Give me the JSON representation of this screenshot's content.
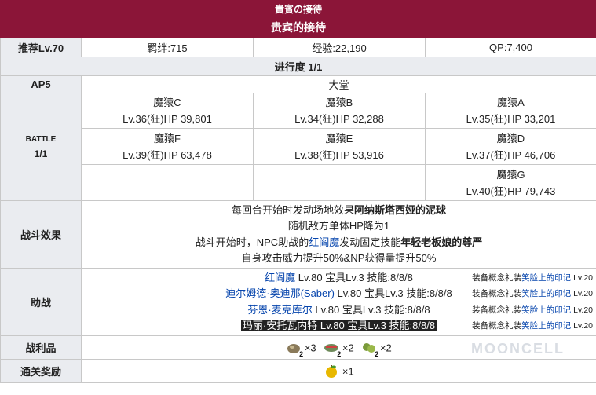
{
  "header": {
    "title_jp": "貴賓の接待",
    "title_cn": "贵宾的接待"
  },
  "summary": {
    "recommended_label": "推荐Lv.70",
    "bond": "羁绊:715",
    "exp": "经验:22,190",
    "qp": "QP:7,400"
  },
  "progress": "进行度 1/1",
  "ap": {
    "label": "AP5",
    "location": "大堂"
  },
  "battle": {
    "label_line1": "BATTLE",
    "label_line2": "1/1",
    "rows": [
      [
        {
          "name": "魔猿C",
          "stats": "Lv.36(狂)HP 39,801"
        },
        {
          "name": "魔猿B",
          "stats": "Lv.34(狂)HP 32,288"
        },
        {
          "name": "魔猿A",
          "stats": "Lv.35(狂)HP 33,201"
        }
      ],
      [
        {
          "name": "魔猿F",
          "stats": "Lv.39(狂)HP 63,478"
        },
        {
          "name": "魔猿E",
          "stats": "Lv.38(狂)HP 53,916"
        },
        {
          "name": "魔猿D",
          "stats": "Lv.37(狂)HP 46,706"
        }
      ],
      [
        {
          "name": "",
          "stats": ""
        },
        {
          "name": "",
          "stats": ""
        },
        {
          "name": "魔猿G",
          "stats": "Lv.40(狂)HP 79,743"
        }
      ]
    ]
  },
  "effects": {
    "label": "战斗效果",
    "line1_pre": "每回合开始时发动场地效果",
    "line1_bold": "阿纳斯塔西娅的泥球",
    "line2": "随机敌方单体HP降为1",
    "line3_pre": "战斗开始时，NPC助战的",
    "line3_link": "红阎魔",
    "line3_mid": "发动固定技能",
    "line3_bold": "年轻老板娘的尊严",
    "line4": "自身攻击威力提升50%&NP获得量提升50%"
  },
  "support": {
    "label": "助战",
    "entries": [
      {
        "servant": "红阎魔",
        "detail": " Lv.80 宝具Lv.3 技能:8/8/8",
        "ce_pre": "装备概念礼装",
        "ce_name": "笑脸上的印记",
        "ce_lv": " Lv.20",
        "highlight": false
      },
      {
        "servant": "迪尔姆德·奥迪那(Saber)",
        "detail": " Lv.80 宝具Lv.3 技能:8/8/8",
        "ce_pre": "装备概念礼装",
        "ce_name": "笑脸上的印记",
        "ce_lv": " Lv.20",
        "highlight": false
      },
      {
        "servant": "芬恩·麦克库尔",
        "detail": " Lv.80 宝具Lv.3 技能:8/8/8",
        "ce_pre": "装备概念礼装",
        "ce_name": "笑脸上的印记",
        "ce_lv": " Lv.20",
        "highlight": false
      },
      {
        "servant": "玛丽·安托瓦内特",
        "detail": " Lv.80 宝具Lv.3 技能:8/8/8",
        "ce_pre": "装备概念礼装",
        "ce_name": "笑脸上的印记",
        "ce_lv": " Lv.20",
        "highlight": true
      }
    ]
  },
  "drops": {
    "label": "战利品",
    "items": [
      {
        "icon": "seed-item-icon",
        "badge": "2",
        "count": "×3",
        "color": "#8a7a5a"
      },
      {
        "icon": "fish-item-icon",
        "badge": "2",
        "count": "×2",
        "color": "#6e8a5a"
      },
      {
        "icon": "leaf-item-icon",
        "badge": "2",
        "count": "×2",
        "color": "#7a9a3a"
      }
    ],
    "watermark": "MOONCELL"
  },
  "clear_reward": {
    "label": "通关奖励",
    "item": {
      "icon": "golden-apple-icon",
      "count": "×1",
      "color": "#e8b800"
    }
  }
}
